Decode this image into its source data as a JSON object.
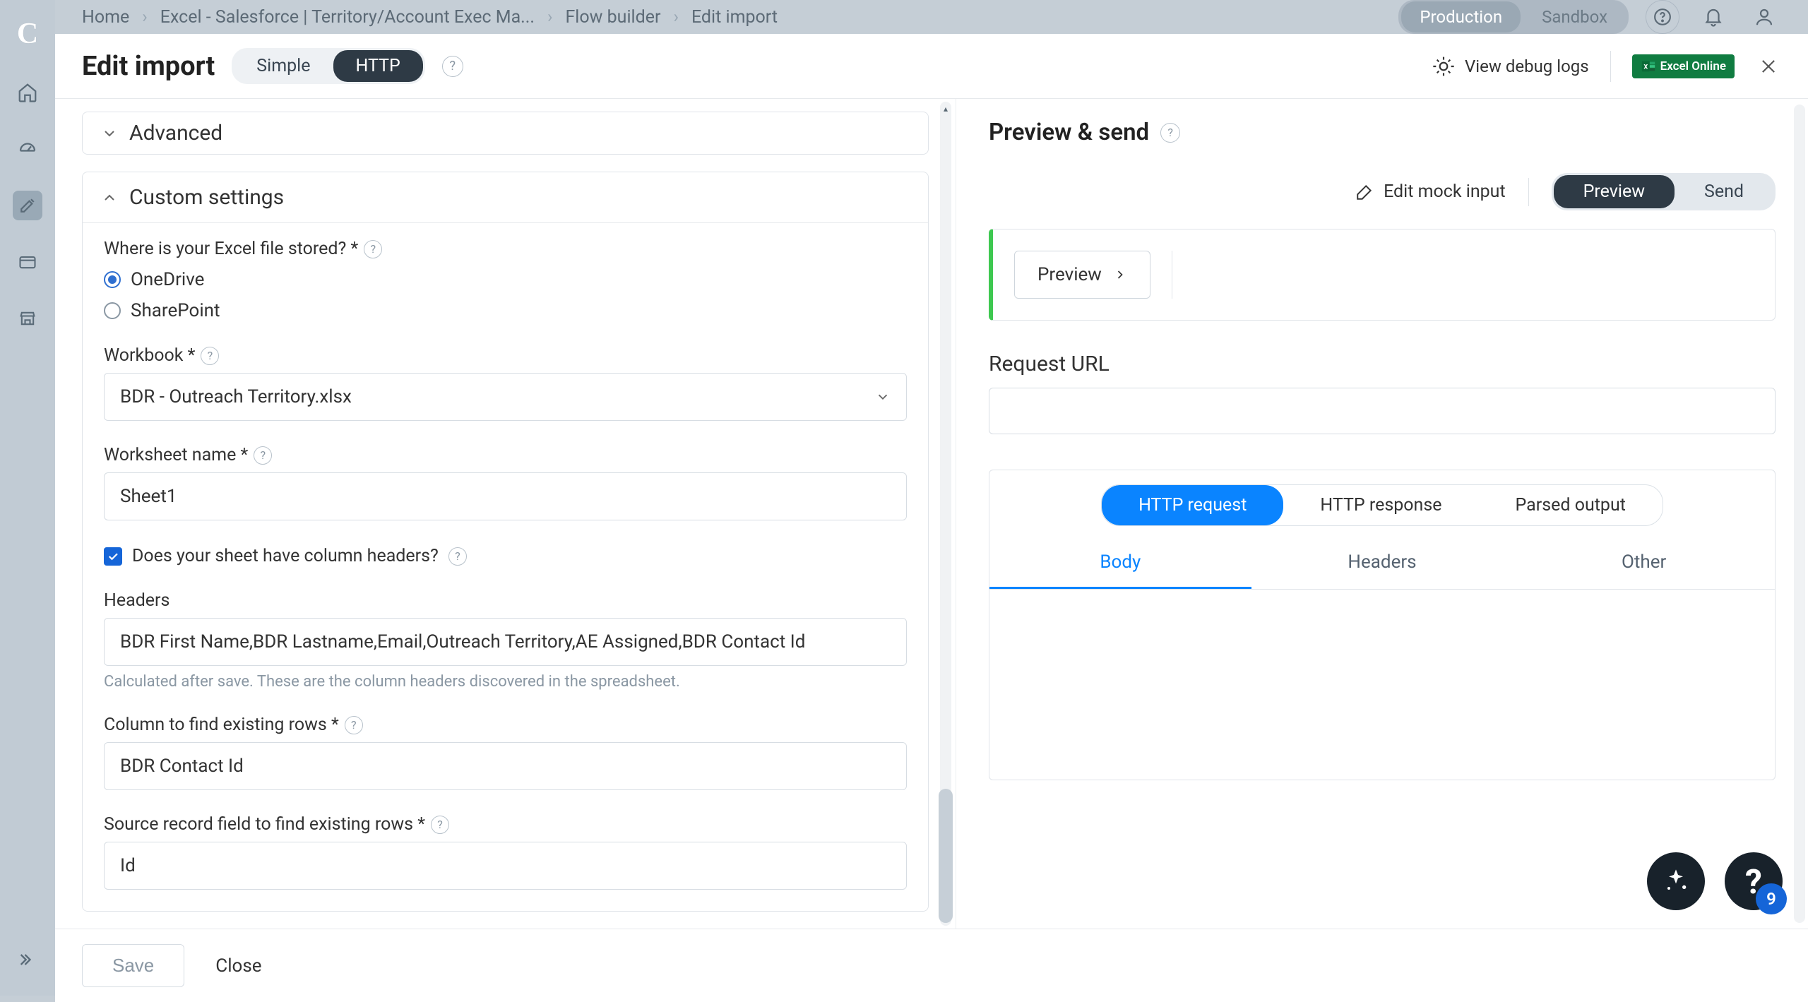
{
  "breadcrumbs": {
    "home": "Home",
    "item2": "Excel - Salesforce | Territory/Account Exec Ma...",
    "item3": "Flow builder",
    "item4": "Edit import"
  },
  "env": {
    "production": "Production",
    "sandbox": "Sandbox"
  },
  "pageTitle": "Edit import",
  "modeToggle": {
    "simple": "Simple",
    "http": "HTTP"
  },
  "debugLogs": "View debug logs",
  "excelBadge": "Excel Online",
  "leftPanel": {
    "advanced": "Advanced",
    "customSettings": "Custom settings",
    "fileStoredLabel": "Where is your Excel file stored? *",
    "radio1": "OneDrive",
    "radio2": "SharePoint",
    "workbookLabel": "Workbook *",
    "workbookValue": "BDR - Outreach Territory.xlsx",
    "worksheetLabel": "Worksheet name *",
    "worksheetValue": "Sheet1",
    "headersCheckboxLabel": "Does your sheet have column headers?",
    "headersLabel": "Headers",
    "headersValue": "BDR First Name,BDR Lastname,Email,Outreach Territory,AE Assigned,BDR Contact Id",
    "headersHint": "Calculated after save. These are the column headers discovered in the spreadsheet.",
    "columnFindLabel": "Column to find existing rows *",
    "columnFindValue": "BDR Contact Id",
    "sourceFieldLabel": "Source record field to find existing rows *",
    "sourceFieldValue": "Id"
  },
  "footer": {
    "save": "Save",
    "close": "Close"
  },
  "rightPanel": {
    "title": "Preview & send",
    "editMock": "Edit mock input",
    "toggle": {
      "preview": "Preview",
      "send": "Send"
    },
    "previewBtn": "Preview",
    "requestUrl": "Request URL",
    "tabs": {
      "httpReq": "HTTP request",
      "httpRes": "HTTP response",
      "parsed": "Parsed output"
    },
    "subtabs": {
      "body": "Body",
      "headers": "Headers",
      "other": "Other"
    }
  },
  "fabBadge": "9"
}
